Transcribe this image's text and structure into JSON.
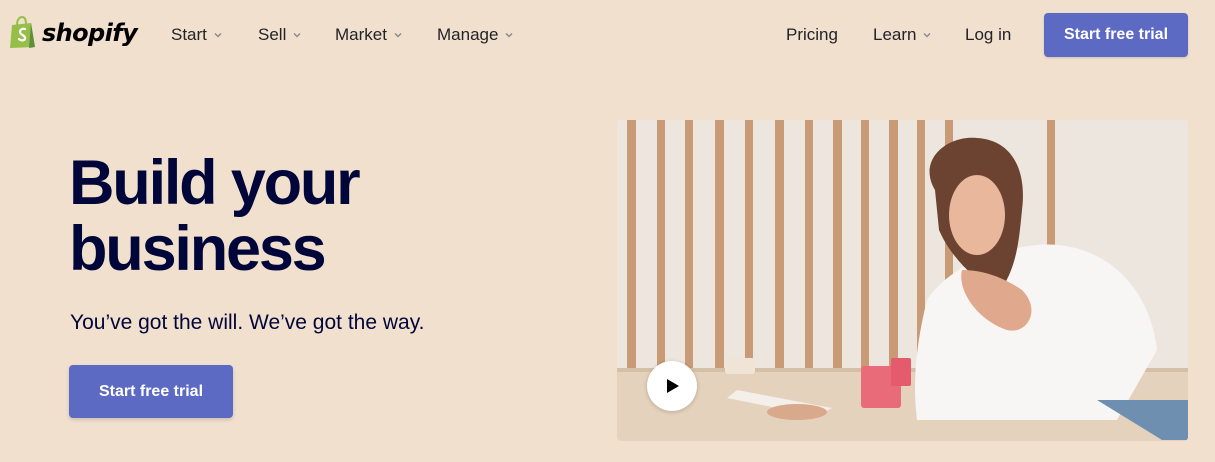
{
  "brand": {
    "name": "shopify",
    "logo_icon": "shopping-bag-icon",
    "logo_color": "#95bf47"
  },
  "nav": {
    "left_items": [
      {
        "label": "Start",
        "has_dropdown": true
      },
      {
        "label": "Sell",
        "has_dropdown": true
      },
      {
        "label": "Market",
        "has_dropdown": true
      },
      {
        "label": "Manage",
        "has_dropdown": true
      }
    ],
    "right_items": [
      {
        "label": "Pricing",
        "has_dropdown": false
      },
      {
        "label": "Learn",
        "has_dropdown": true
      },
      {
        "label": "Log in",
        "has_dropdown": false
      }
    ],
    "cta_label": "Start free trial"
  },
  "hero": {
    "title": "Build your business",
    "subtitle": "You’ve got the will. We’ve got the way.",
    "cta_label": "Start free trial"
  },
  "video": {
    "play_icon": "play-icon"
  },
  "colors": {
    "background": "#f2e0cf",
    "accent": "#5c6ac4",
    "heading": "#000639",
    "text": "#212326"
  }
}
